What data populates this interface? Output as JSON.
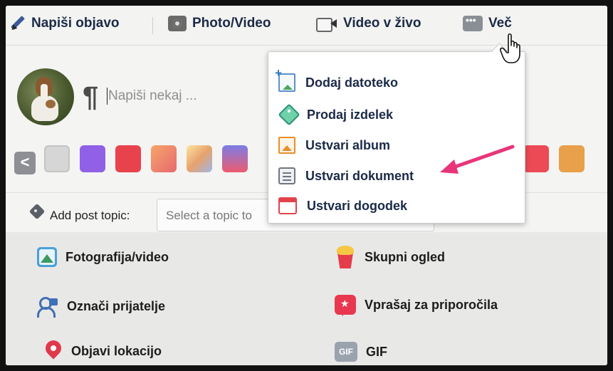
{
  "toolbar": {
    "write_post": "Napiši objavo",
    "photo_video": "Photo/Video",
    "live_video": "Video v živo",
    "more": "Več"
  },
  "composer": {
    "placeholder": "Napiši nekaj ...",
    "pilcrow": "¶"
  },
  "colors": {
    "prev_label": "<",
    "swatches": [
      "#d8d8d8",
      "#8f5ee8",
      "#e83c48",
      "#f07f6f",
      "#f5a35f",
      "#e0536f",
      "#f4b85a",
      "#f2a24a",
      "#ef4b57",
      "#e79b4b"
    ]
  },
  "topic": {
    "label": "Add post topic:",
    "select_placeholder": "Select a topic to"
  },
  "options": {
    "photo_video": "Fotografija/video",
    "watch_party": "Skupni ogled",
    "tag_friends": "Označi prijatelje",
    "ask_recommendations": "Vprašaj za priporočila",
    "check_in": "Objavi lokacijo",
    "gif": "GIF",
    "gif_icon": "GIF"
  },
  "dropdown": {
    "items": [
      {
        "label": "Dodaj datoteko",
        "icon": "file-add-icon"
      },
      {
        "label": "Prodaj izdelek",
        "icon": "price-tag-icon"
      },
      {
        "label": "Ustvari album",
        "icon": "album-icon"
      },
      {
        "label": "Ustvari dokument",
        "icon": "document-icon"
      },
      {
        "label": "Ustvari dogodek",
        "icon": "calendar-icon"
      }
    ]
  },
  "annotation_color": "#e8357a"
}
